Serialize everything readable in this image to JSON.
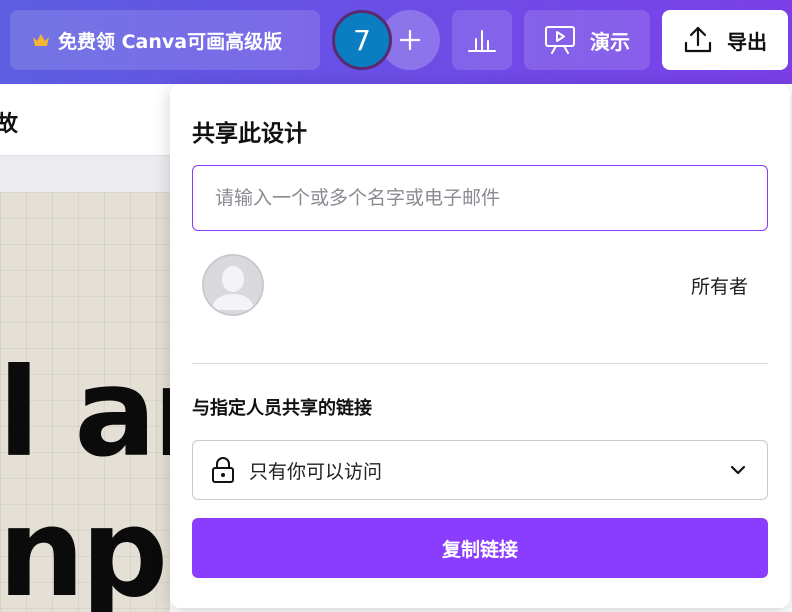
{
  "topbar": {
    "premium_label": "免费领 Canva可画高级版",
    "collaborator_count": "7",
    "present_label": "演示",
    "export_label": "导出"
  },
  "background": {
    "subbar_text": "故",
    "canvas_lines": [
      "l ar",
      "nple"
    ]
  },
  "share_panel": {
    "title": "共享此设计",
    "invite_placeholder": "请输入一个或多个名字或电子邮件",
    "invite_value": "",
    "owner_role": "所有者",
    "link_heading": "与指定人员共享的链接",
    "access_option": "只有你可以访问",
    "copy_link_label": "复制链接"
  },
  "colors": {
    "topbar_gradient_start": "#5b5ee0",
    "topbar_gradient_end": "#7b3fe8",
    "accent_purple": "#8b3dff",
    "crown": "#f2b533",
    "collaborator_badge": "#0b7dc1"
  },
  "icons": {
    "premium": "crown-icon",
    "add": "plus-icon",
    "stats": "bar-chart-icon",
    "present": "presentation-icon",
    "export": "upload-icon",
    "owner": "person-silhouette-icon",
    "access": "lock-icon",
    "dropdown": "chevron-down-icon"
  }
}
